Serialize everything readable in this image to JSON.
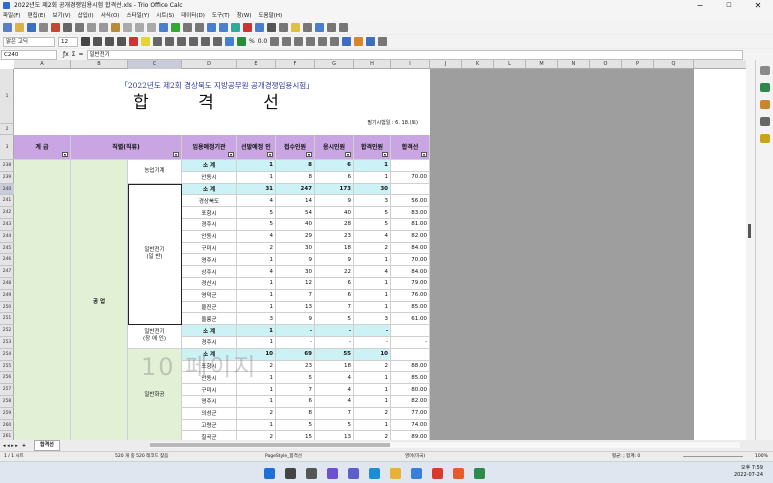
{
  "window": {
    "title": "2022년도 제2회 공개경쟁임용시험 합격선.xls - Trio Office Calc",
    "controls": [
      "−",
      "☐",
      "✕"
    ]
  },
  "menu": [
    "파일(F)",
    "편집(E)",
    "보기(V)",
    "삽입(I)",
    "서식(O)",
    "스타일(Y)",
    "시트(S)",
    "데이터(D)",
    "도구(T)",
    "창(W)",
    "도움말(H)"
  ],
  "format": {
    "font_name": "맑은 고딕",
    "font_size": "12",
    "zoom_pct": "%",
    "decimal": "0.0"
  },
  "formula_bar": {
    "name_box": "C240",
    "content": "일반전기"
  },
  "columns": [
    "A",
    "B",
    "C",
    "D",
    "E",
    "F",
    "G",
    "H",
    "I",
    "J",
    "K",
    "L",
    "M",
    "N",
    "O",
    "P",
    "Q"
  ],
  "selected_col": "C",
  "sheet": {
    "title_line1": "「2022년도 제2회 경상북도 지방공무원 공개경쟁임용시험」",
    "title_line2": "합 격 선",
    "date_note": "필기시험일 : 6. 18.(토)",
    "headers": {
      "grade": "계 급",
      "job": "직렬(직류)",
      "agency": "임용예정기관",
      "selected": "선발예정 인",
      "applied": "접수인원",
      "attended": "응시인원",
      "passed": "합격인원",
      "cutoff": "합격선"
    },
    "group_gongeop": "공 업",
    "group_agri_machine": "농업기계",
    "group_elec": "일반전기\n(일 반)",
    "group_elec_disabled": "일반전기\n(장 애 인)",
    "group_chem": "일반화공",
    "rows": [
      {
        "r": "238",
        "agency": "소 계",
        "sel": "1",
        "app": "8",
        "att": "6",
        "pas": "1",
        "cut": "",
        "cls": "cyan"
      },
      {
        "r": "239",
        "agency": "안동시",
        "sel": "1",
        "app": "8",
        "att": "6",
        "pas": "1",
        "cut": "70.00",
        "cls": ""
      },
      {
        "r": "240",
        "agency": "소 계",
        "sel": "31",
        "app": "247",
        "att": "173",
        "pas": "30",
        "cut": "",
        "cls": "cyan"
      },
      {
        "r": "241",
        "agency": "경상북도",
        "sel": "4",
        "app": "14",
        "att": "9",
        "pas": "3",
        "cut": "56.00",
        "cls": ""
      },
      {
        "r": "242",
        "agency": "포항시",
        "sel": "5",
        "app": "54",
        "att": "40",
        "pas": "5",
        "cut": "83.00",
        "cls": ""
      },
      {
        "r": "243",
        "agency": "경주시",
        "sel": "5",
        "app": "40",
        "att": "28",
        "pas": "5",
        "cut": "81.00",
        "cls": ""
      },
      {
        "r": "244",
        "agency": "안동시",
        "sel": "4",
        "app": "29",
        "att": "23",
        "pas": "4",
        "cut": "82.00",
        "cls": ""
      },
      {
        "r": "245",
        "agency": "구미시",
        "sel": "2",
        "app": "30",
        "att": "18",
        "pas": "2",
        "cut": "84.00",
        "cls": ""
      },
      {
        "r": "246",
        "agency": "영주시",
        "sel": "1",
        "app": "9",
        "att": "9",
        "pas": "1",
        "cut": "70.00",
        "cls": ""
      },
      {
        "r": "247",
        "agency": "상주시",
        "sel": "4",
        "app": "30",
        "att": "22",
        "pas": "4",
        "cut": "84.00",
        "cls": ""
      },
      {
        "r": "248",
        "agency": "경산시",
        "sel": "1",
        "app": "12",
        "att": "6",
        "pas": "1",
        "cut": "79.00",
        "cls": ""
      },
      {
        "r": "249",
        "agency": "영덕군",
        "sel": "1",
        "app": "7",
        "att": "6",
        "pas": "1",
        "cut": "76.00",
        "cls": ""
      },
      {
        "r": "250",
        "agency": "울진군",
        "sel": "1",
        "app": "13",
        "att": "7",
        "pas": "1",
        "cut": "85.00",
        "cls": ""
      },
      {
        "r": "251",
        "agency": "울릉군",
        "sel": "3",
        "app": "9",
        "att": "5",
        "pas": "3",
        "cut": "61.00",
        "cls": ""
      },
      {
        "r": "252",
        "agency": "소 계",
        "sel": "1",
        "app": "-",
        "att": "-",
        "pas": "-",
        "cut": "",
        "cls": "cyan"
      },
      {
        "r": "253",
        "agency": "경주시",
        "sel": "1",
        "app": "-",
        "att": "-",
        "pas": "-",
        "cut": "-",
        "cls": ""
      },
      {
        "r": "254",
        "agency": "소 계",
        "sel": "10",
        "app": "69",
        "att": "55",
        "pas": "10",
        "cut": "",
        "cls": "cyan"
      },
      {
        "r": "255",
        "agency": "포항시",
        "sel": "2",
        "app": "23",
        "att": "18",
        "pas": "2",
        "cut": "88.00",
        "cls": ""
      },
      {
        "r": "256",
        "agency": "안동시",
        "sel": "1",
        "app": "5",
        "att": "4",
        "pas": "1",
        "cut": "85.00",
        "cls": ""
      },
      {
        "r": "257",
        "agency": "구미시",
        "sel": "1",
        "app": "7",
        "att": "4",
        "pas": "1",
        "cut": "80.00",
        "cls": ""
      },
      {
        "r": "258",
        "agency": "영주시",
        "sel": "1",
        "app": "6",
        "att": "4",
        "pas": "1",
        "cut": "82.00",
        "cls": ""
      },
      {
        "r": "259",
        "agency": "의성군",
        "sel": "2",
        "app": "8",
        "att": "7",
        "pas": "2",
        "cut": "77.00",
        "cls": ""
      },
      {
        "r": "260",
        "agency": "고령군",
        "sel": "1",
        "app": "5",
        "att": "5",
        "pas": "1",
        "cut": "74.00",
        "cls": ""
      },
      {
        "r": "261",
        "agency": "칠곡군",
        "sel": "2",
        "app": "15",
        "att": "13",
        "pas": "2",
        "cut": "89.00",
        "cls": ""
      }
    ],
    "watermark": "10 페이지"
  },
  "tabs": {
    "sheet_name": "합격선"
  },
  "status": {
    "sheet": "1 / 1 시트",
    "records": "520 개 중 520 레코드 찾음",
    "page_style": "PageStyle_합격선",
    "lang": "영어(미국)",
    "sum": "평균: ; 합계: 0",
    "zoom": "100%"
  },
  "clock": {
    "time": "오후 7:59",
    "date": "2022-07-24"
  }
}
